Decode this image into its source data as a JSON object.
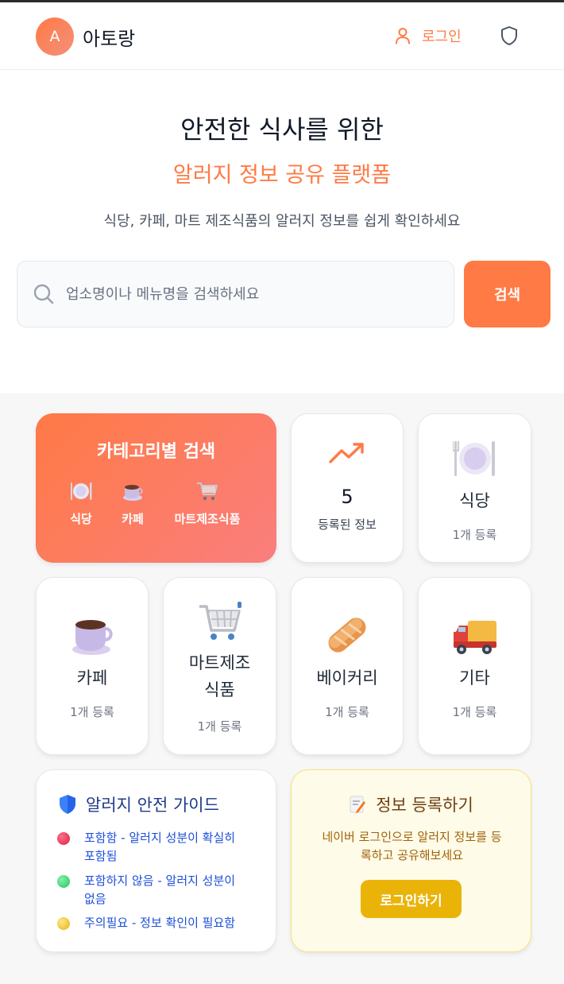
{
  "header": {
    "avatar_letter": "A",
    "app_name": "아토랑",
    "login_label": "로그인"
  },
  "hero": {
    "title": "안전한 식사를 위한",
    "subtitle": "알러지 정보 공유 플랫폼",
    "description": "식당, 카페, 마트 제조식품의 알러지 정보를 쉽게 확인하세요"
  },
  "search": {
    "placeholder": "업소명이나 메뉴명을 검색하세요",
    "value": "",
    "button_label": "검색"
  },
  "category_search": {
    "title": "카테고리별 검색",
    "items": [
      {
        "label": "식당",
        "icon": "plate-icon"
      },
      {
        "label": "카페",
        "icon": "coffee-icon"
      },
      {
        "label": "마트제조식품",
        "icon": "cart-icon"
      }
    ]
  },
  "stats": {
    "count": "5",
    "label": "등록된 정보",
    "icon": "trending-up-icon"
  },
  "categories": [
    {
      "name": "식당",
      "count": "1개 등록",
      "icon": "plate-icon"
    },
    {
      "name": "카페",
      "count": "1개 등록",
      "icon": "coffee-icon"
    },
    {
      "name_line1": "마트제조",
      "name_line2": "식품",
      "count": "1개 등록",
      "icon": "cart-icon"
    },
    {
      "name": "베이커리",
      "count": "1개 등록",
      "icon": "bread-icon"
    },
    {
      "name": "기타",
      "count": "1개 등록",
      "icon": "truck-icon"
    }
  ],
  "guide": {
    "title": "알러지 안전 가이드",
    "items": [
      {
        "line1": "포함함 - 알러지 성분이 확실히",
        "line2": "포함됨",
        "color": "#e11d48"
      },
      {
        "line1": "포함하지 않음 - 알러지 성분이",
        "line2": "없음",
        "color": "#22c55e"
      },
      {
        "line1": "주의필요 - 정보 확인이 필요함",
        "line2": "",
        "color": "#eab308"
      }
    ]
  },
  "register": {
    "title": "정보 등록하기",
    "desc_line1": "네이버 로그인으로 알러지 정보를 등",
    "desc_line2": "록하고 공유해보세요",
    "button_label": "로그인하기"
  },
  "colors": {
    "accent": "#ff7a45",
    "guide_text": "#1d4ed8",
    "register_button": "#eab308"
  }
}
